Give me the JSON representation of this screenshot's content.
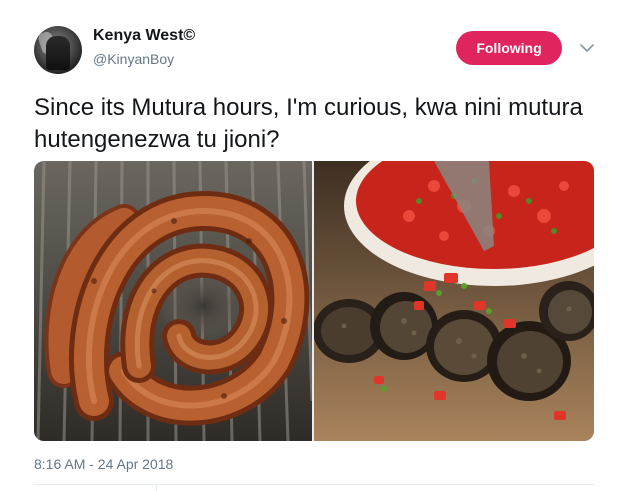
{
  "author": {
    "display_name": "Kenya West©",
    "handle": "@KinyanBoy"
  },
  "follow_button": {
    "label": "Following",
    "color": "#e0245e"
  },
  "menu": {
    "icon": "chevron-down-icon"
  },
  "tweet": {
    "text": "Since its Mutura hours, I'm curious, kwa nini mutura hutengenezwa tu jioni?",
    "timestamp": "8:16 AM - 24 Apr 2018"
  },
  "media": [
    {
      "name": "grilled-sausage-coil-photo"
    },
    {
      "name": "sliced-mutura-with-kachumbari-photo"
    }
  ],
  "colors": {
    "accent": "#e0245e",
    "text": "#14171a",
    "secondary_text": "#657786",
    "divider": "#e6ecf0"
  }
}
